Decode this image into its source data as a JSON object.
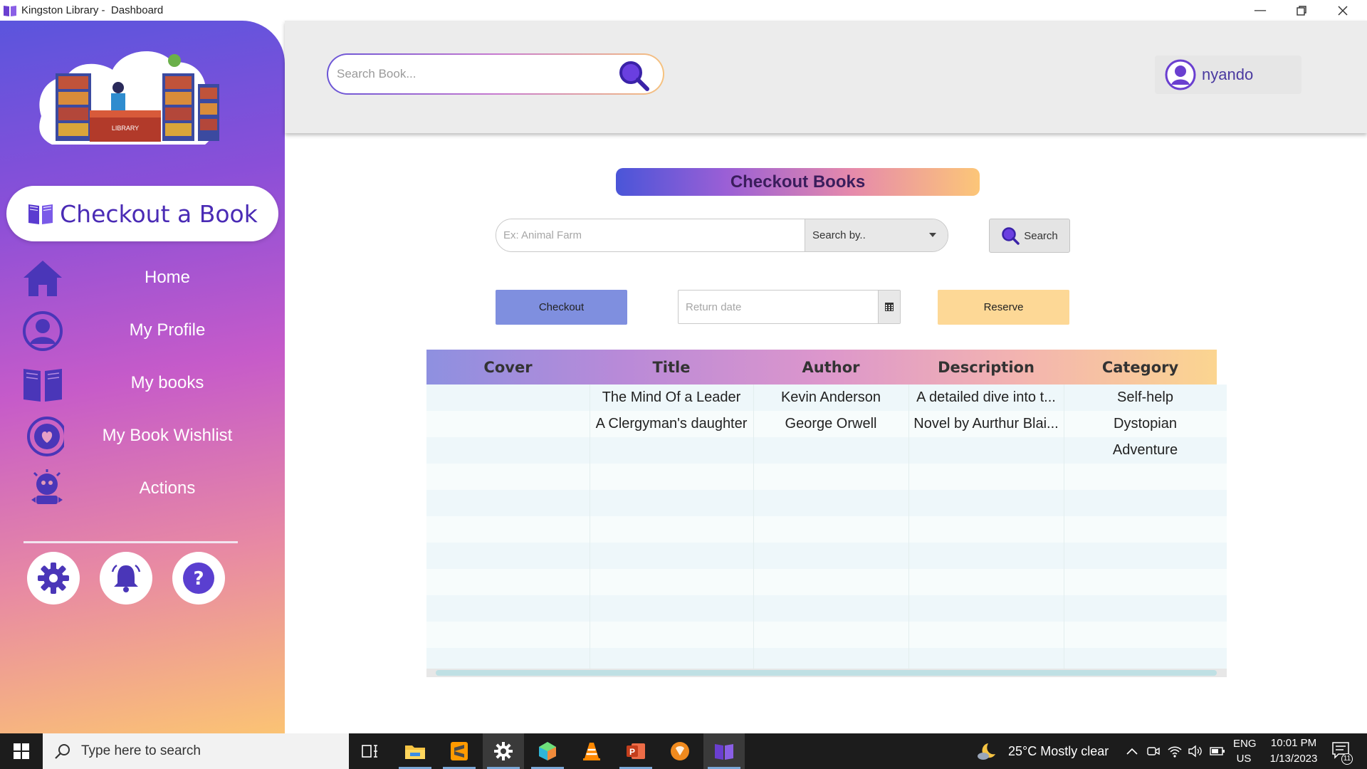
{
  "window": {
    "title": "Kingston Library -  Dashboard",
    "controls": [
      "minimize-icon",
      "restore-icon",
      "close-icon"
    ]
  },
  "sidebar": {
    "logo_text": "LIBRARY",
    "cta_label": "Checkout a Book",
    "items": [
      {
        "label": "Home",
        "icon": "home-icon"
      },
      {
        "label": "My Profile",
        "icon": "user-icon"
      },
      {
        "label": "My books",
        "icon": "book-icon"
      },
      {
        "label": "My Book Wishlist",
        "icon": "heart-icon"
      },
      {
        "label": "Actions",
        "icon": "actions-icon"
      }
    ],
    "bottom_buttons": [
      "gear-icon",
      "bell-icon",
      "help-icon"
    ]
  },
  "header": {
    "search_placeholder": "Search Book...",
    "username": "nyando"
  },
  "main": {
    "title": "Checkout Books",
    "filter_placeholder": "Ex: Animal Farm",
    "search_by_label": "Search by..",
    "search_button": "Search",
    "checkout_button": "Checkout",
    "return_date_placeholder": "Return date",
    "reserve_button": "Reserve"
  },
  "table": {
    "columns": [
      "Cover",
      "Title",
      "Author",
      "Description",
      "Category"
    ],
    "rows": [
      [
        "",
        "The Mind Of a Leader",
        "Kevin Anderson",
        "A detailed dive into t...",
        "Self-help"
      ],
      [
        "",
        "A Clergyman's daughter",
        "George Orwell",
        "Novel by Aurthur Blai...",
        "Dystopian"
      ],
      [
        "",
        "",
        "",
        "",
        "Adventure"
      ]
    ]
  },
  "taskbar": {
    "search_placeholder": "Type here to search",
    "apps": [
      "task-view-icon",
      "file-explorer-icon",
      "sublime-text-icon",
      "settings-icon",
      "app-cube-icon",
      "vlc-icon",
      "powerpoint-icon",
      "app-orange-icon",
      "library-app-icon"
    ],
    "weather": "25°C  Mostly clear",
    "lang": "ENG",
    "region": "US",
    "time": "10:01 PM",
    "date": "1/13/2023",
    "notification_count": "11"
  },
  "colors": {
    "brand_purple": "#4a2bb5",
    "checkout_blue": "#7f8fdf",
    "reserve_yellow": "#fdd896"
  }
}
